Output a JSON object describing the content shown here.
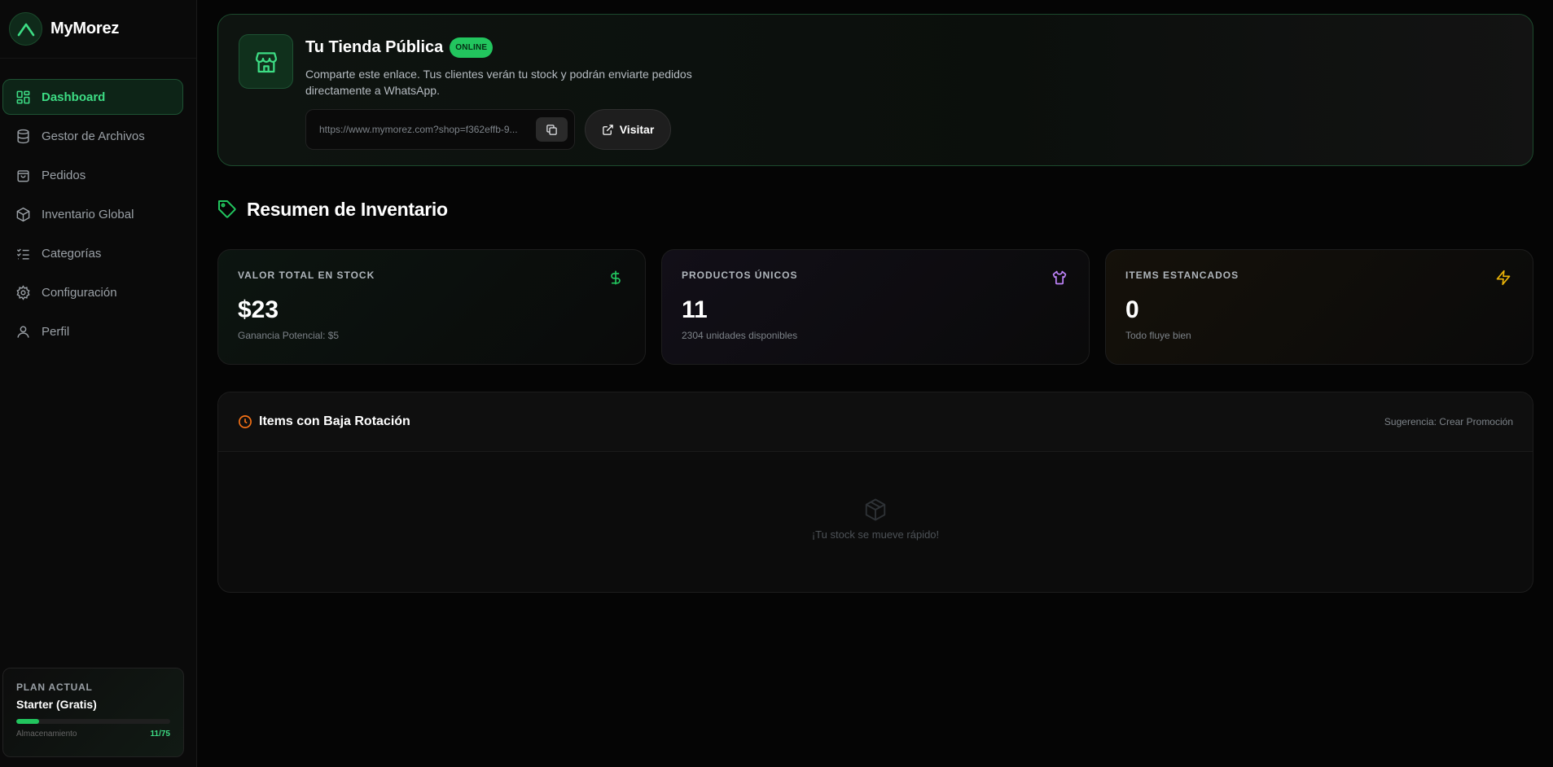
{
  "brand": {
    "name": "MyMorez"
  },
  "sidebar": {
    "items": [
      {
        "label": "Dashboard",
        "icon": "dashboard-icon",
        "active": true
      },
      {
        "label": "Gestor de Archivos",
        "icon": "database-icon"
      },
      {
        "label": "Pedidos",
        "icon": "shopping-bag-icon"
      },
      {
        "label": "Inventario Global",
        "icon": "box-icon"
      },
      {
        "label": "Categorías",
        "icon": "list-checks-icon"
      },
      {
        "label": "Configuración",
        "icon": "gear-icon"
      },
      {
        "label": "Perfil",
        "icon": "user-icon"
      }
    ],
    "plan": {
      "label": "PLAN ACTUAL",
      "name": "Starter (Gratis)",
      "storage_label": "Almacenamiento",
      "storage_count": "11/75",
      "storage_fraction": 0.147
    }
  },
  "store": {
    "title": "Tu Tienda Pública",
    "badge": "ONLINE",
    "description": "Comparte este enlace. Tus clientes verán tu stock y podrán enviarte pedidos directamente a WhatsApp.",
    "url": "https://www.mymorez.com?shop=f362effb-9...",
    "visit_label": "Visitar"
  },
  "summary": {
    "title": "Resumen de Inventario",
    "cards": [
      {
        "label": "VALOR TOTAL EN STOCK",
        "value": "$23",
        "sub": "Ganancia Potencial: $5",
        "icon": "dollar-icon",
        "color": "#22c55e"
      },
      {
        "label": "PRODUCTOS ÚNICOS",
        "value": "11",
        "sub": "2304 unidades disponibles",
        "icon": "shirt-icon",
        "color": "#c084fc"
      },
      {
        "label": "ITEMS ESTANCADOS",
        "value": "0",
        "sub": "Todo fluye bien",
        "icon": "bolt-icon",
        "color": "#eab308"
      }
    ]
  },
  "slow_rotation": {
    "title": "Items con Baja Rotación",
    "suggestion": "Sugerencia: Crear Promoción",
    "empty_text": "¡Tu stock se mueve rápido!",
    "accent": "#f97316"
  }
}
